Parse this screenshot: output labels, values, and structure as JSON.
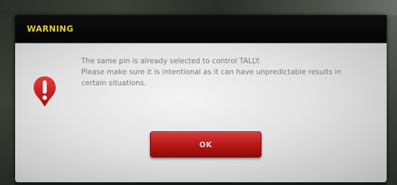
{
  "dialog": {
    "title": "WARNING",
    "icon": "exclamation-warning-icon",
    "message_lines": [
      "The same pin is already selected to control TALLY.",
      "Please make sure it is intentional as it can have unpredictable results in",
      "certain situations."
    ],
    "ok_label": "OK"
  },
  "colors": {
    "title": "#d8c94a",
    "button": "#b51616",
    "icon": "#c81e1e",
    "message_text": "#7a7a7a"
  }
}
